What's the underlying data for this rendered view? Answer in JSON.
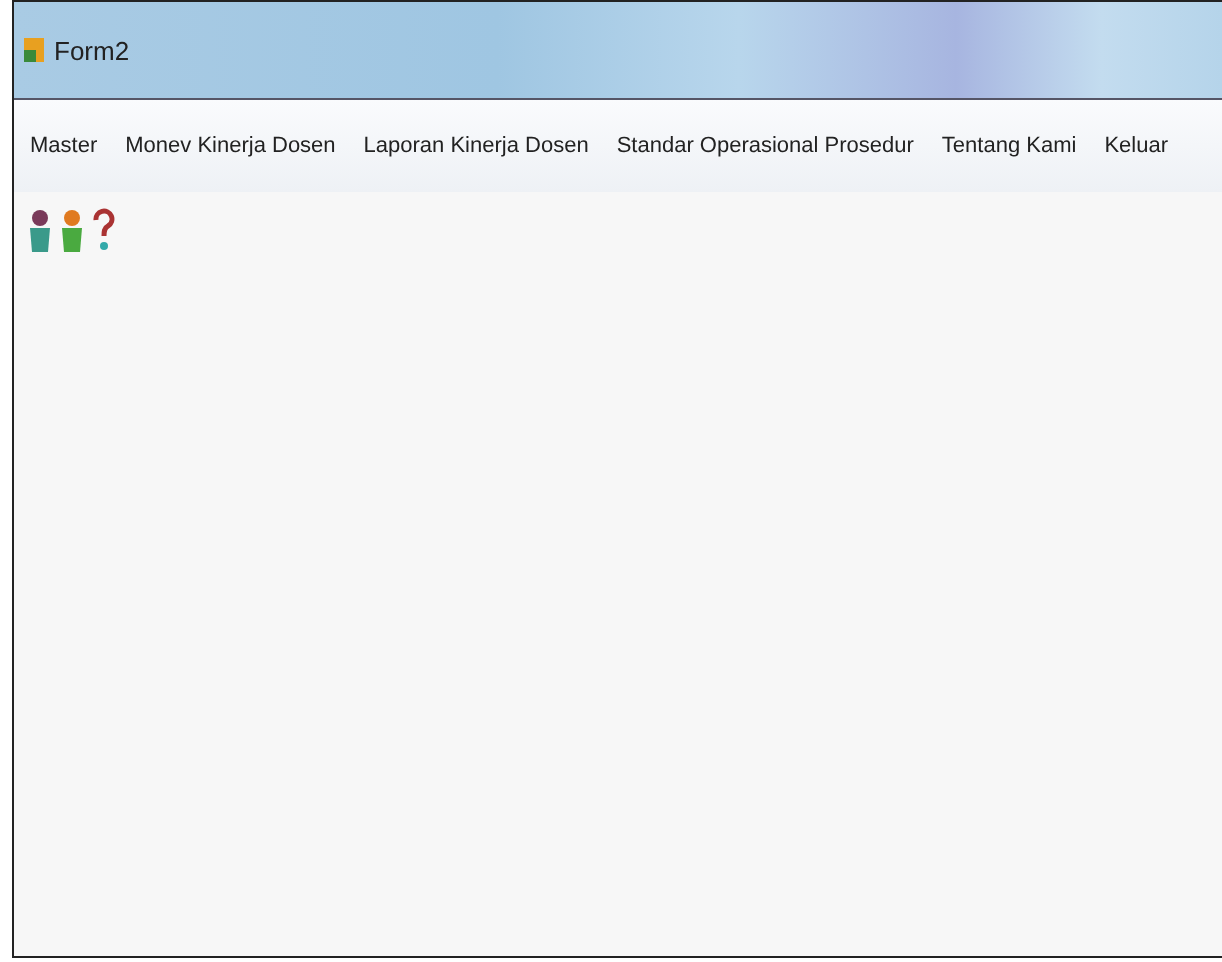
{
  "window": {
    "title": "Form2"
  },
  "menu": [
    {
      "label": "Master"
    },
    {
      "label": "Monev Kinerja Dosen"
    },
    {
      "label": "Laporan Kinerja Dosen"
    },
    {
      "label": "Standar Operasional Prosedur"
    },
    {
      "label": "Tentang Kami"
    },
    {
      "label": "Keluar"
    }
  ],
  "toolbar": [
    {
      "kind": "person"
    },
    {
      "kind": "person"
    },
    {
      "kind": "help"
    }
  ]
}
